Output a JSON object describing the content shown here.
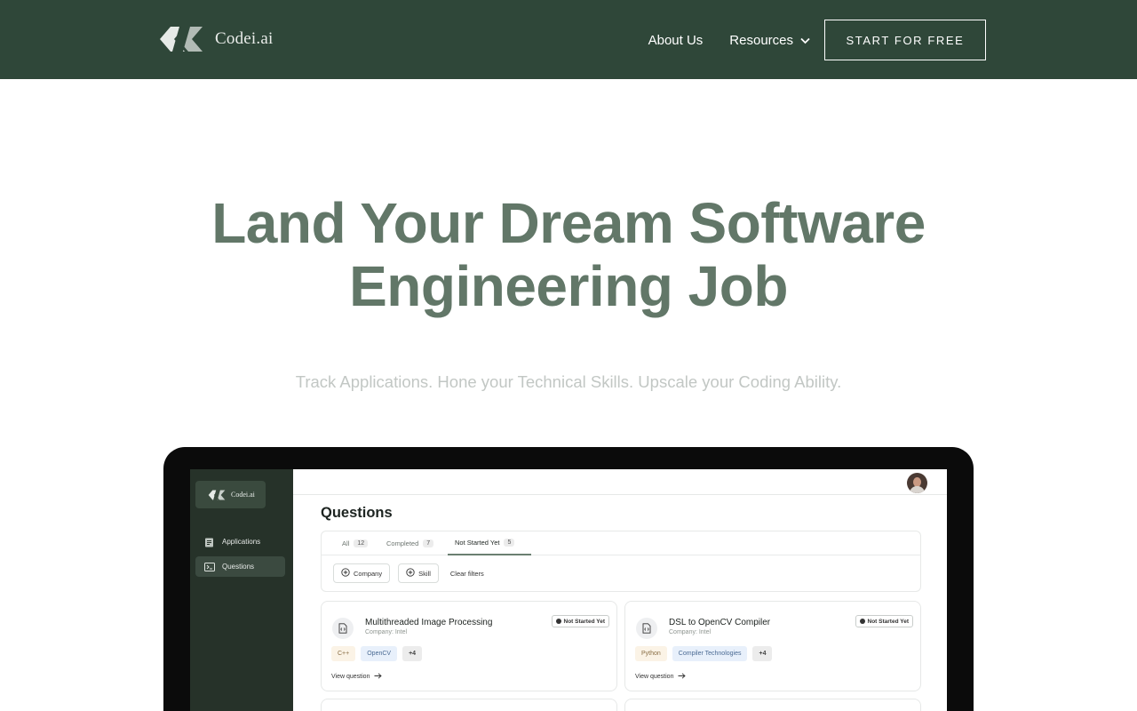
{
  "header": {
    "brand_name": "Codei.ai",
    "nav": {
      "about": "About Us",
      "resources": "Resources"
    },
    "cta_label": "START FOR FREE"
  },
  "hero": {
    "title_line1": "Land Your Dream Software",
    "title_line2": "Engineering Job",
    "subtitle": "Track Applications. Hone your Technical Skills. Upscale your Coding Ability."
  },
  "app_preview": {
    "brand_name": "Codei.ai",
    "sidebar": [
      {
        "label": "Applications",
        "icon": "document-icon"
      },
      {
        "label": "Questions",
        "icon": "terminal-icon",
        "active": true
      }
    ],
    "page_title": "Questions",
    "tabs": [
      {
        "label": "All",
        "count": "12"
      },
      {
        "label": "Completed",
        "count": "7"
      },
      {
        "label": "Not Started Yet",
        "count": "5",
        "active": true
      }
    ],
    "filters": {
      "company": "Company",
      "skill": "Skill",
      "clear": "Clear filters"
    },
    "cards": [
      {
        "title": "Multithreaded Image Processing",
        "company": "Company: Intel",
        "status": "Not Started Yet",
        "tags": [
          "C++",
          "OpenCV"
        ],
        "more": "+4",
        "link": "View question"
      },
      {
        "title": "DSL to OpenCV Compiler",
        "company": "Company: Intel",
        "status": "Not Started Yet",
        "tags": [
          "Python",
          "Compiler Technologies"
        ],
        "more": "+4",
        "link": "View question"
      }
    ]
  },
  "colors": {
    "nav_bg": "#2f4739",
    "hero_title": "#627768",
    "hero_subtitle": "#c2c7c4",
    "app_sidebar": "#263229"
  }
}
